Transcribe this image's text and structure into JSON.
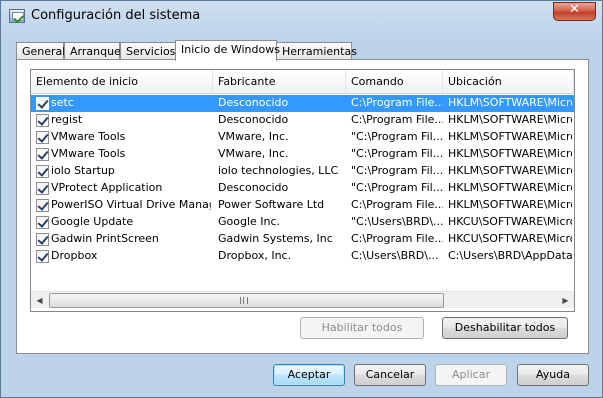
{
  "window": {
    "title": "Configuración del sistema",
    "close_glyph": "✕"
  },
  "tabs": [
    {
      "label": "General"
    },
    {
      "label": "Arranque"
    },
    {
      "label": "Servicios"
    },
    {
      "label": "Inicio de Windows",
      "active": true
    },
    {
      "label": "Herramientas"
    }
  ],
  "listview": {
    "columns": [
      "Elemento de inicio",
      "Fabricante",
      "Comando",
      "Ubicación"
    ],
    "rows": [
      {
        "checked": true,
        "item": "setc",
        "maker": "Desconocido",
        "command": "C:\\Program File...",
        "location": "HKLM\\SOFTWARE\\Micros",
        "selected": true
      },
      {
        "checked": true,
        "item": "regist",
        "maker": "Desconocido",
        "command": "C:\\Program File...",
        "location": "HKLM\\SOFTWARE\\Micros"
      },
      {
        "checked": true,
        "item": "VMware Tools",
        "maker": "VMware, Inc.",
        "command": "\"C:\\Program Fil...",
        "location": "HKLM\\SOFTWARE\\Micros"
      },
      {
        "checked": true,
        "item": "VMware Tools",
        "maker": "VMware, Inc.",
        "command": "\"C:\\Program Fil...",
        "location": "HKLM\\SOFTWARE\\Micros"
      },
      {
        "checked": true,
        "item": "iolo Startup",
        "maker": "iolo technologies, LLC",
        "command": "\"C:\\Program Fil...",
        "location": "HKLM\\SOFTWARE\\Micros"
      },
      {
        "checked": true,
        "item": "VProtect Application",
        "maker": "Desconocido",
        "command": "\"C:\\Program Fil...",
        "location": "HKLM\\SOFTWARE\\Micros"
      },
      {
        "checked": true,
        "item": "PowerISO Virtual Drive Manager",
        "maker": "Power Software Ltd",
        "command": "C:\\Program File...",
        "location": "HKLM\\SOFTWARE\\Micros"
      },
      {
        "checked": true,
        "item": "Google Update",
        "maker": "Google Inc.",
        "command": "\"C:\\Users\\BRD\\...",
        "location": "HKCU\\SOFTWARE\\Micros"
      },
      {
        "checked": true,
        "item": "Gadwin PrintScreen",
        "maker": "Gadwin Systems, Inc",
        "command": "C:\\Program File...",
        "location": "HKCU\\SOFTWARE\\Micros"
      },
      {
        "checked": true,
        "item": "Dropbox",
        "maker": "Dropbox, Inc.",
        "command": "C:\\Users\\BRD\\...",
        "location": "C:\\Users\\BRD\\AppData\\"
      }
    ]
  },
  "scrollbar": {
    "left_arrow": "◀",
    "right_arrow": "▶"
  },
  "panel_buttons": {
    "enable_all": "Habilitar todos",
    "disable_all": "Deshabilitar todos"
  },
  "dialog_buttons": {
    "accept": "Aceptar",
    "cancel": "Cancelar",
    "apply": "Aplicar",
    "help": "Ayuda"
  }
}
